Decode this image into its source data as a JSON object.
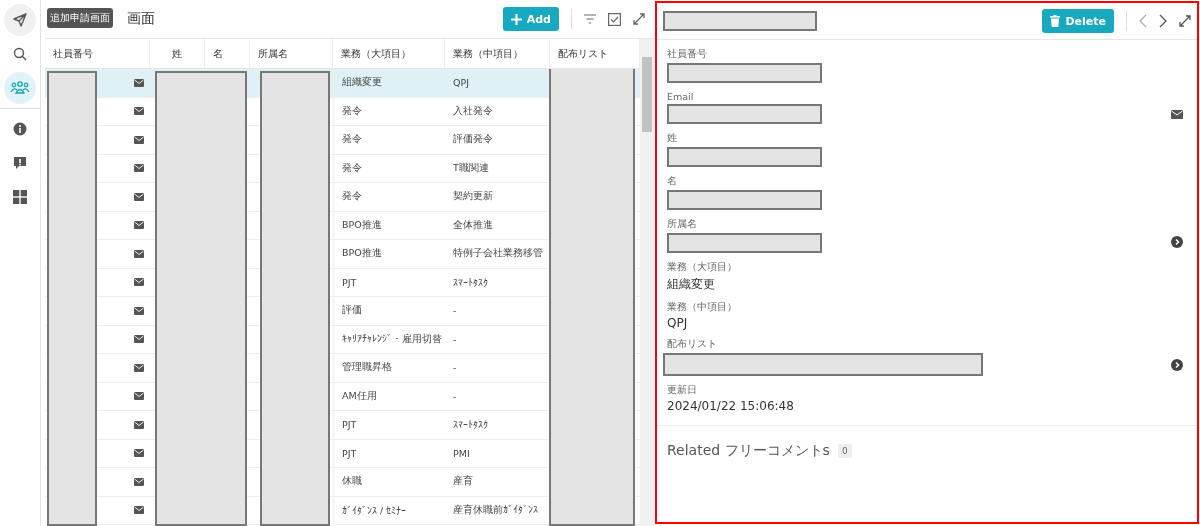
{
  "sidebar": {
    "items": [
      {
        "selected": false
      },
      {
        "selected": false
      },
      {
        "selected": true
      },
      {
        "selected": false
      },
      {
        "selected": false
      },
      {
        "selected": false
      }
    ],
    "tooltip": "追加申請画面"
  },
  "list": {
    "title": "画面",
    "add_button": "Add",
    "columns": [
      "社員番号",
      "姓",
      "名",
      "所属名",
      "業務（大項目）",
      "業務（中項目）",
      "配布リスト"
    ],
    "rows": [
      {
        "major": "組織変更",
        "minor": "QPJ",
        "selected": true
      },
      {
        "major": "発令",
        "minor": "入社発令",
        "selected": false
      },
      {
        "major": "発令",
        "minor": "評価発令",
        "selected": false
      },
      {
        "major": "発令",
        "minor": "T職関連",
        "selected": false
      },
      {
        "major": "発令",
        "minor": "契約更新",
        "selected": false
      },
      {
        "major": "BPO推進",
        "minor": "全体推進",
        "selected": false
      },
      {
        "major": "BPO推進",
        "minor": "特例子会社業務移管",
        "selected": false
      },
      {
        "major": "PJT",
        "minor": "ｽﾏｰﾄﾀｽｸ",
        "selected": false
      },
      {
        "major": "評価",
        "minor": "-",
        "selected": false
      },
      {
        "major": "ｷｬﾘｱﾁｬﾚﾝｼﾞ・雇用切替",
        "minor": "-",
        "selected": false
      },
      {
        "major": "管理職昇格",
        "minor": "-",
        "selected": false
      },
      {
        "major": "AM任用",
        "minor": "-",
        "selected": false
      },
      {
        "major": "PJT",
        "minor": "ｽﾏｰﾄﾀｽｸ",
        "selected": false
      },
      {
        "major": "PJT",
        "minor": "PMI",
        "selected": false
      },
      {
        "major": "休職",
        "minor": "産育",
        "selected": false
      },
      {
        "major": "ｶﾞｲﾀﾞﾝｽ / ｾﾐﾅｰ",
        "minor": "産育休職前ｶﾞｲﾀﾞﾝｽ",
        "selected": false
      }
    ]
  },
  "detail": {
    "delete_button": "Delete",
    "fields": [
      {
        "label": "社員番号",
        "kind": "redacted"
      },
      {
        "label": "Email",
        "kind": "redacted_mail"
      },
      {
        "label": "姓",
        "kind": "redacted"
      },
      {
        "label": "名",
        "kind": "redacted"
      },
      {
        "label": "所属名",
        "kind": "redacted_link"
      },
      {
        "label": "業務（大項目）",
        "kind": "text",
        "value": "組織変更"
      },
      {
        "label": "業務（中項目）",
        "kind": "text",
        "value": "QPJ"
      },
      {
        "label": "配布リスト",
        "kind": "redacted_wide_link"
      },
      {
        "label": "更新日",
        "kind": "text",
        "value": "2024/01/22 15:06:48"
      }
    ],
    "related": {
      "title": "Related フリーコメントs",
      "count": "0"
    }
  }
}
